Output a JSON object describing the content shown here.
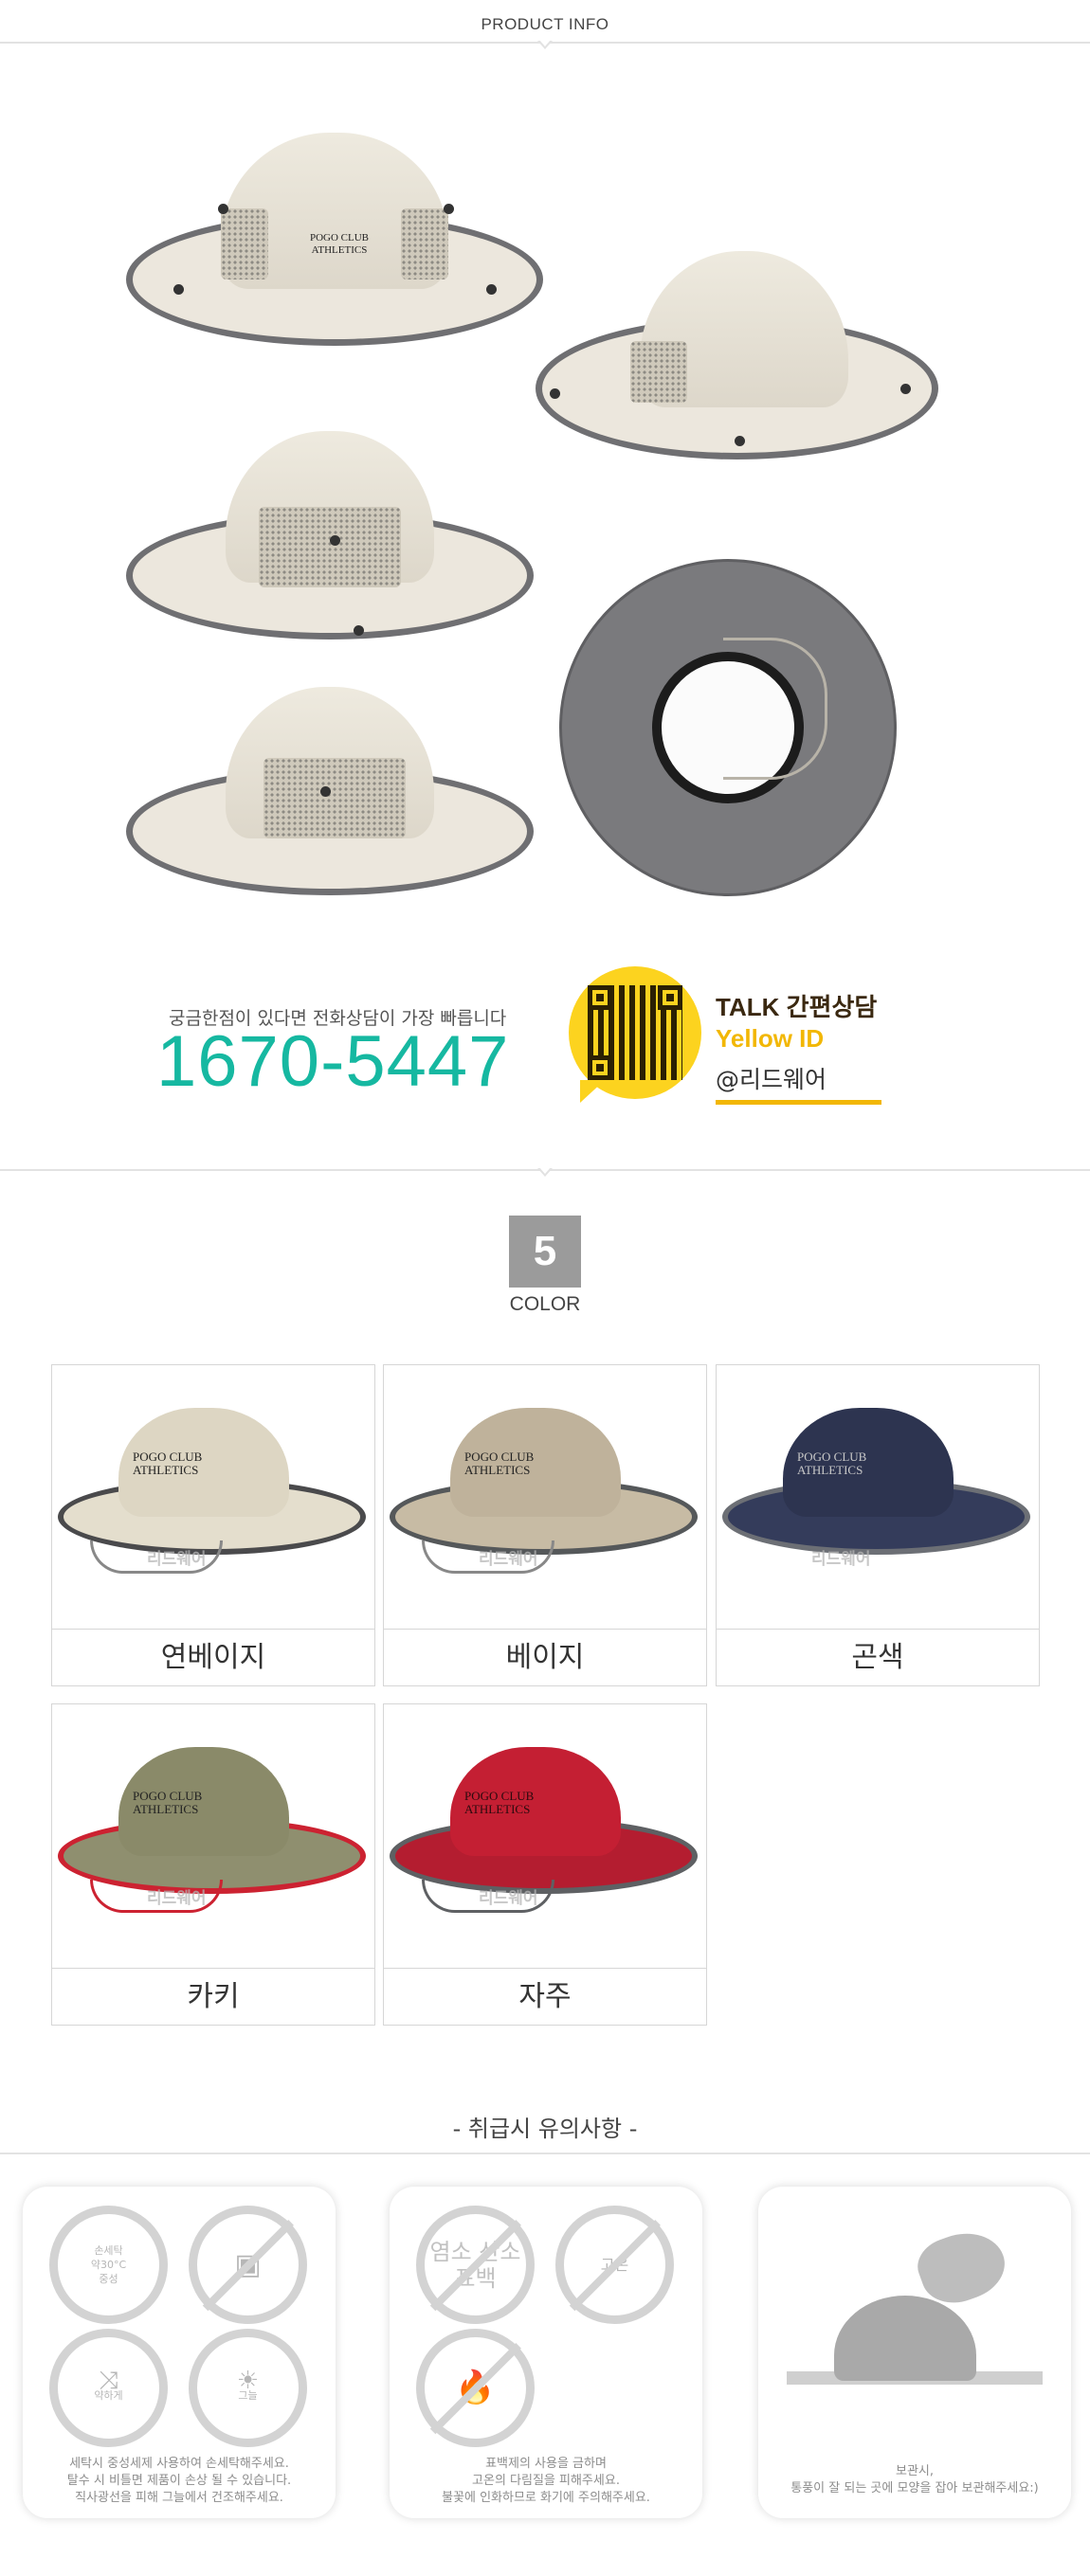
{
  "header": {
    "title": "PRODUCT INFO"
  },
  "product": {
    "logo_line1": "POGO CLUB",
    "logo_line2": "ATHLETICS"
  },
  "contact": {
    "caption": "궁금한점이 있다면 전화상담이 가장 빠릅니다",
    "phone": "1670-5447",
    "talk_line1": "TALK 간편상담",
    "talk_line2": "Yellow ID",
    "talk_line3": "@리드웨어"
  },
  "colors": {
    "count": "5",
    "label": "COLOR",
    "watermark": "리드웨어",
    "items": [
      {
        "name": "연베이지",
        "crown": "#ddd6c3",
        "brim": "#e4decd",
        "trim": "#4a4a4c"
      },
      {
        "name": "베이지",
        "crown": "#bfb29b",
        "brim": "#c7bba4",
        "trim": "#55585a"
      },
      {
        "name": "곤색",
        "crown": "#2d3450",
        "brim": "#343c5b",
        "trim": "#6c6f75"
      },
      {
        "name": "카키",
        "crown": "#8a8a69",
        "brim": "#8f8f6f",
        "trim": "#cc2231"
      },
      {
        "name": "자주",
        "crown": "#c41f33",
        "brim": "#b41d30",
        "trim": "#5e6063"
      }
    ]
  },
  "care": {
    "title": "- 취급시 유의사항 -",
    "card1": {
      "icon1_line1": "손세탁",
      "icon1_line2": "약30°C",
      "icon1_line3": "중성",
      "icon3": "약하게",
      "icon4": "그늘",
      "text_line1": "세탁시 중성세제 사용하여 손세탁해주세요.",
      "text_line2": "탈수 시 비틀면 제품이 손상 될 수 있습니다.",
      "text_line3": "직사광선을 피해 그늘에서 건조해주세요."
    },
    "card2": {
      "icon1": "염소 산소표백",
      "icon2": "고온",
      "text_line1": "표백제의 사용을 금하며",
      "text_line2": "고온의 다림질을 피해주세요.",
      "text_line3": "불꽃에 인화하므로 화기에 주의해주세요."
    },
    "card3": {
      "text_line1": "보관시,",
      "text_line2": "통풍이 잘 되는 곳에 모양을 잡아 보관해주세요:)"
    }
  }
}
